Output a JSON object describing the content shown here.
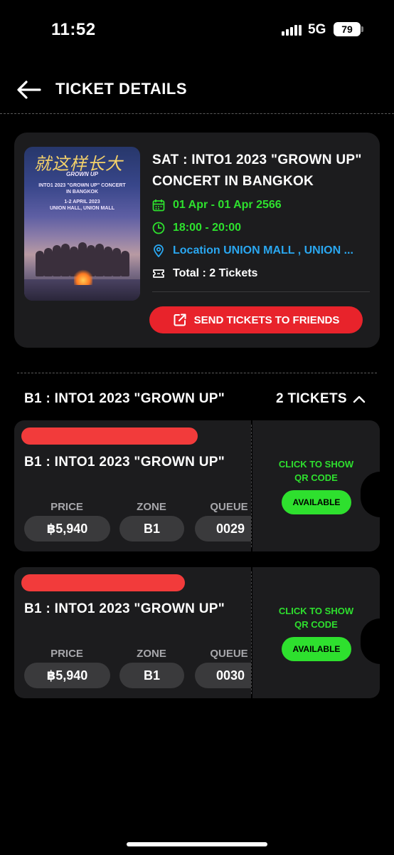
{
  "status_bar": {
    "time": "11:52",
    "network": "5G",
    "battery": "79"
  },
  "header": {
    "title": "TICKET DETAILS"
  },
  "event": {
    "title": "SAT : INTO1 2023 \"GROWN UP\" CONCERT IN BANGKOK",
    "date": "01 Apr - 01 Apr 2566",
    "time": "18:00 - 20:00",
    "location": "Location UNION MALL , UNION ...",
    "total": "Total : 2 Tickets",
    "send_button": "SEND TICKETS TO FRIENDS",
    "poster": {
      "logo": "就这样长大",
      "subtitle": "GROWN UP",
      "line1": "INTO1 2023 \"GROWN UP\" CONCERT",
      "line2": "IN BANGKOK",
      "line3": "1-2 APRIL 2023",
      "line4": "UNION HALL, UNION MALL"
    }
  },
  "section": {
    "title": "B1 : INTO1 2023 \"GROWN UP\"",
    "count": "2 TICKETS"
  },
  "tickets": [
    {
      "name": "B1 : INTO1 2023 \"GROWN UP\"",
      "price_label": "PRICE",
      "price": "฿5,940",
      "zone_label": "ZONE",
      "zone": "B1",
      "queue_label": "QUEUE",
      "queue": "0029",
      "qr_line1": "CLICK TO SHOW",
      "qr_line2": "QR CODE",
      "status": "AVAILABLE"
    },
    {
      "name": "B1 : INTO1 2023 \"GROWN UP\"",
      "price_label": "PRICE",
      "price": "฿5,940",
      "zone_label": "ZONE",
      "zone": "B1",
      "queue_label": "QUEUE",
      "queue": "0030",
      "qr_line1": "CLICK TO SHOW",
      "qr_line2": "QR CODE",
      "status": "AVAILABLE"
    }
  ],
  "colors": {
    "accent_red": "#e8232b",
    "accent_green": "#2ee02e",
    "link_blue": "#2aa7f0",
    "card_bg": "#1c1c1e"
  }
}
